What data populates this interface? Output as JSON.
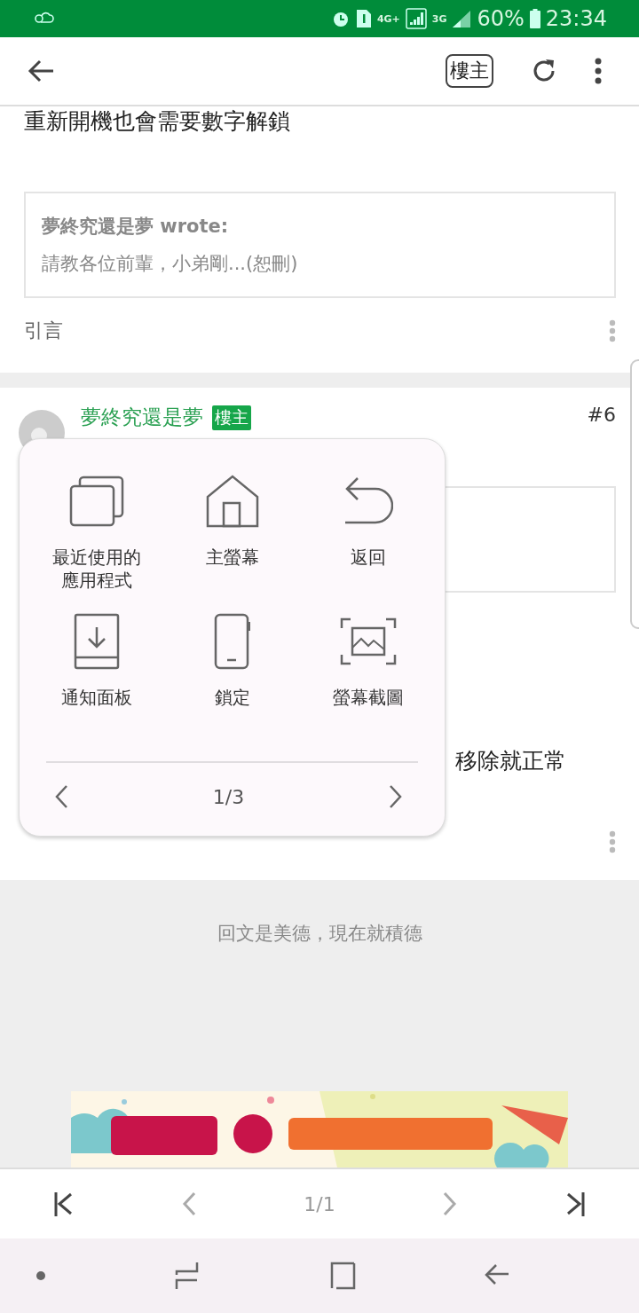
{
  "status_bar": {
    "network_1": "4G+",
    "network_2": "3G",
    "battery": "60%",
    "time": "23:34"
  },
  "toolbar": {
    "op_button": "樓主"
  },
  "posts": [
    {
      "body": "重新開機也會需要數字解鎖",
      "quote": {
        "author": "夢終究還是夢 wrote:",
        "text": "請教各位前輩，小弟剛...(恕刪)"
      },
      "quote_link": "引言"
    },
    {
      "author": "夢終究還是夢",
      "badge": "樓主",
      "floor": "#6",
      "body": "移除就正常"
    }
  ],
  "reply_prompt": "回文是美德，現在就積德",
  "pager": {
    "page": "1/1"
  },
  "assistant_menu": {
    "items": [
      {
        "kind": "recent",
        "label": "最近使用的應用程式"
      },
      {
        "kind": "home",
        "label": "主螢幕"
      },
      {
        "kind": "back",
        "label": "返回"
      },
      {
        "kind": "notifications",
        "label": "通知面板"
      },
      {
        "kind": "lock",
        "label": "鎖定"
      },
      {
        "kind": "screenshot",
        "label": "螢幕截圖"
      }
    ],
    "page": "1/3"
  }
}
